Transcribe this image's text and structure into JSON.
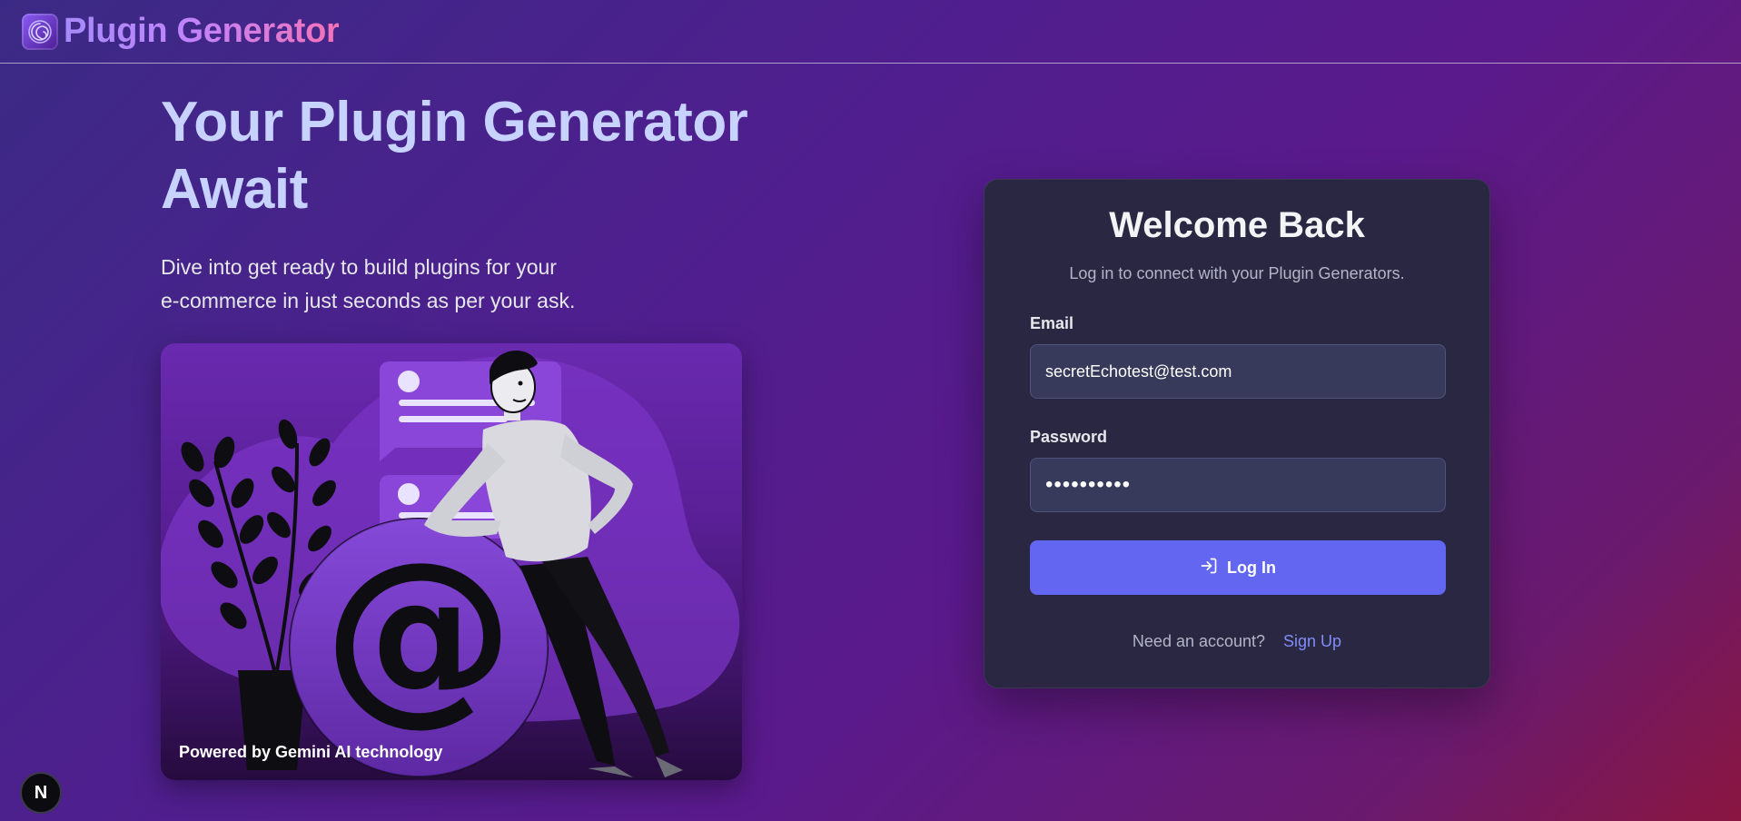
{
  "brand": {
    "name": "Plugin Generator",
    "logo_icon": "spiral-logo-icon"
  },
  "hero": {
    "title": "Your Plugin Generator Await",
    "subtitle_line1": "Dive into get ready to build plugins for your",
    "subtitle_line2": "e-commerce in just seconds as per your ask.",
    "powered_by": "Powered by Gemini AI technology"
  },
  "login": {
    "title": "Welcome Back",
    "subtitle": "Log in to connect with your Plugin Generators.",
    "email_label": "Email",
    "email_value": "secretEchotest@test.com",
    "password_label": "Password",
    "password_value": "••••••••••",
    "button_label": "Log In",
    "button_icon": "log-in-icon",
    "signup_prompt": "Need an account?",
    "signup_link": "Sign Up"
  },
  "dev_badge": {
    "letter": "N"
  },
  "colors": {
    "accent": "#6366f1",
    "link": "#818cf8",
    "card": "#2a2742",
    "input": "#373a5a"
  }
}
